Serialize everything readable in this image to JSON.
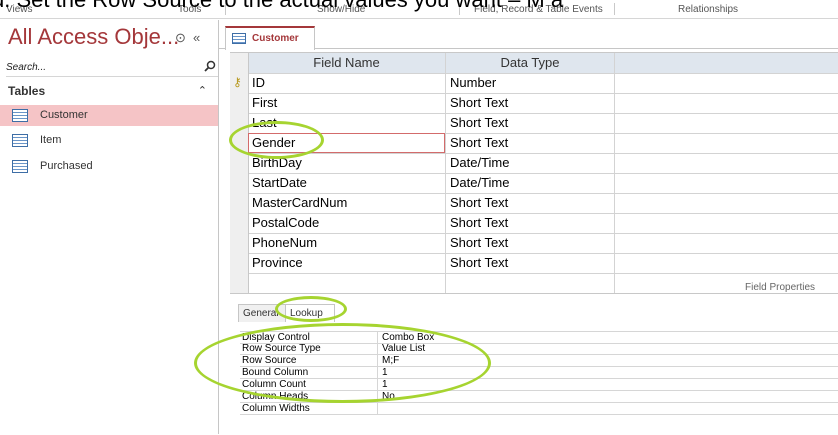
{
  "caption": "d.  Set the Row Source to the actual values you want – M a",
  "ribbon": {
    "groups": [
      "Views",
      "Tools",
      "Show/Hide",
      "Field, Record & Table Events",
      "Relationships"
    ]
  },
  "nav": {
    "title": "All Access Obje...",
    "search_placeholder": "Search...",
    "group_label": "Tables",
    "items": [
      {
        "label": "Customer",
        "selected": true
      },
      {
        "label": "Item",
        "selected": false
      },
      {
        "label": "Purchased",
        "selected": false
      }
    ]
  },
  "document_tab": {
    "label": "Customer"
  },
  "design_grid": {
    "headers": {
      "field_name": "Field Name",
      "data_type": "Data Type"
    },
    "rows": [
      {
        "field": "ID",
        "type": "Number",
        "primary_key": true
      },
      {
        "field": "First",
        "type": "Short Text"
      },
      {
        "field": "Last",
        "type": "Short Text"
      },
      {
        "field": "Gender",
        "type": "Short Text",
        "active": true
      },
      {
        "field": "BirthDay",
        "type": "Date/Time"
      },
      {
        "field": "StartDate",
        "type": "Date/Time"
      },
      {
        "field": "MasterCardNum",
        "type": "Short Text"
      },
      {
        "field": "PostalCode",
        "type": "Short Text"
      },
      {
        "field": "PhoneNum",
        "type": "Short Text"
      },
      {
        "field": "Province",
        "type": "Short Text"
      }
    ]
  },
  "field_properties": {
    "label": "Field Properties",
    "tabs": [
      "General",
      "Lookup"
    ],
    "active_tab": "Lookup",
    "rows": [
      {
        "name": "Display Control",
        "value": "Combo Box"
      },
      {
        "name": "Row Source Type",
        "value": "Value List"
      },
      {
        "name": "Row Source",
        "value": "M;F"
      },
      {
        "name": "Bound Column",
        "value": "1"
      },
      {
        "name": "Column Count",
        "value": "1"
      },
      {
        "name": "Column Heads",
        "value": "No"
      },
      {
        "name": "Column Widths",
        "value": ""
      }
    ]
  },
  "colors": {
    "accent": "#a4373a",
    "highlight": "#a6d430",
    "selection": "#f5c4c6"
  }
}
